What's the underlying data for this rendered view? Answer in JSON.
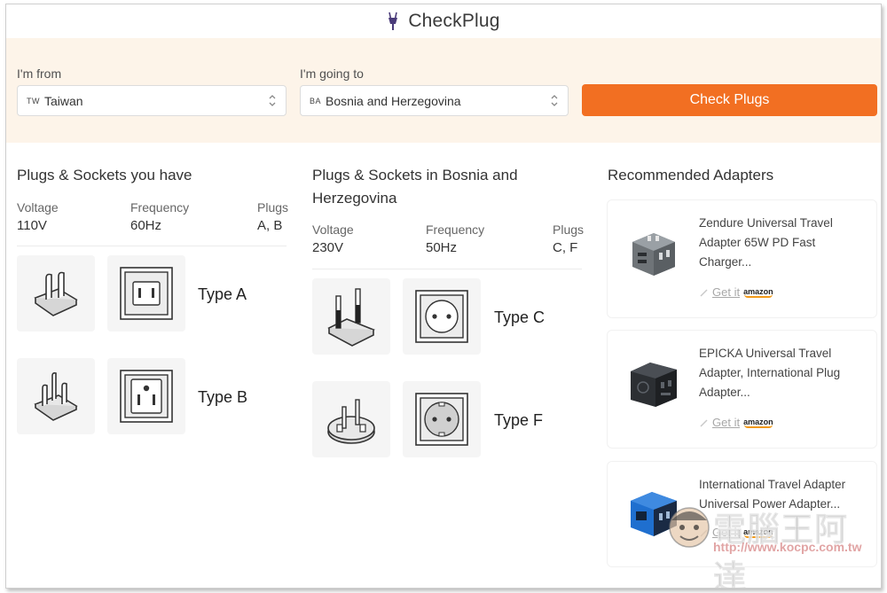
{
  "app": {
    "title": "CheckPlug"
  },
  "search": {
    "from_label": "I'm from",
    "from_code": "TW",
    "from_value": "Taiwan",
    "to_label": "I'm going to",
    "to_code": "BA",
    "to_value": "Bosnia and Herzegovina",
    "button_label": "Check Plugs"
  },
  "have": {
    "title": "Plugs & Sockets you have",
    "voltage_label": "Voltage",
    "voltage": "110V",
    "frequency_label": "Frequency",
    "frequency": "60Hz",
    "plugs_label": "Plugs",
    "plugs": "A, B",
    "types": [
      {
        "label": "Type A",
        "plug_icon": "type-a-plug-icon",
        "socket_icon": "type-a-socket-icon"
      },
      {
        "label": "Type B",
        "plug_icon": "type-b-plug-icon",
        "socket_icon": "type-b-socket-icon"
      }
    ]
  },
  "destination": {
    "title_line1": "Plugs & Sockets in Bosnia and",
    "title_line2": "Herzegovina",
    "voltage_label": "Voltage",
    "voltage": "230V",
    "frequency_label": "Frequency",
    "frequency": "50Hz",
    "plugs_label": "Plugs",
    "plugs": "C, F",
    "types": [
      {
        "label": "Type C",
        "plug_icon": "type-c-plug-icon",
        "socket_icon": "type-c-socket-icon"
      },
      {
        "label": "Type F",
        "plug_icon": "type-f-plug-icon",
        "socket_icon": "type-f-socket-icon"
      }
    ]
  },
  "adapters": {
    "title": "Recommended Adapters",
    "items": [
      {
        "line1": "Zendure Universal Travel",
        "line2": "Adapter 65W PD Fast",
        "line3": "Charger...",
        "link": "Get it",
        "store": "amazon"
      },
      {
        "line1": "EPICKA Universal Travel",
        "line2": "Adapter, International Plug",
        "line3": "Adapter...",
        "link": "Get it",
        "store": "amazon"
      },
      {
        "line1": "International Travel Adapter",
        "line2": "Universal Power Adapter...",
        "line3": "",
        "link": "Get it",
        "store": "amazon"
      }
    ]
  },
  "watermark": {
    "text": "電腦王阿達",
    "url": "http://www.kocpc.com.tw"
  },
  "colors": {
    "accent": "#f26f22",
    "band": "#fdf4e9",
    "tile": "#f5f5f5"
  }
}
